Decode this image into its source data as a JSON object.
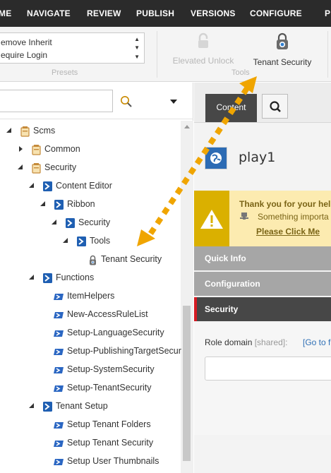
{
  "menu": {
    "items": [
      {
        "key": "home",
        "label": "ME"
      },
      {
        "key": "navigate",
        "label": "NAVIGATE"
      },
      {
        "key": "review",
        "label": "REVIEW"
      },
      {
        "key": "publish",
        "label": "PUBLISH"
      },
      {
        "key": "versions",
        "label": "VERSIONS"
      },
      {
        "key": "configure",
        "label": "CONFIGURE"
      },
      {
        "key": "more",
        "label": "P"
      }
    ]
  },
  "ribbon": {
    "presets_list": [
      "emove Inherit",
      "equire Login"
    ],
    "presets_group_label": "Presets",
    "tools_group_label": "Tools",
    "elevated_unlock_label": "Elevated Unlock",
    "tenant_security_label": "Tenant Security"
  },
  "tree": {
    "search_placeholder": "",
    "nodes": [
      {
        "label": "Scms"
      },
      {
        "label": "Common"
      },
      {
        "label": "Security"
      },
      {
        "label": "Content Editor"
      },
      {
        "label": "Ribbon"
      },
      {
        "label": "Security"
      },
      {
        "label": "Tools"
      },
      {
        "label": "Tenant Security"
      },
      {
        "label": "Functions"
      },
      {
        "label": "ItemHelpers"
      },
      {
        "label": "New-AccessRuleList"
      },
      {
        "label": "Setup-LanguageSecurity"
      },
      {
        "label": "Setup-PublishingTargetSecur"
      },
      {
        "label": "Setup-SystemSecurity"
      },
      {
        "label": "Setup-TenantSecurity"
      },
      {
        "label": "Tenant Setup"
      },
      {
        "label": "Setup Tenant Folders"
      },
      {
        "label": "Setup Tenant Security"
      },
      {
        "label": "Setup User Thumbnails"
      }
    ]
  },
  "editor": {
    "content_tab_label": "Content",
    "item_title": "play1",
    "notice_line1": "Thank you for your hel",
    "notice_line2": "Something importa",
    "notice_link": "Please Click Me",
    "sections": [
      "Quick Info",
      "Configuration",
      "Security"
    ],
    "role_domain_label": "Role domain",
    "role_domain_shared": "[shared]:",
    "go_link": "[Go to f"
  },
  "colors": {
    "menubar_bg": "#2b2b2b",
    "annotation_arrow": "#f0a500",
    "section_active_accent": "#d51b23",
    "powershell_blue": "#1f5fb2",
    "warning_yellow": "#dab000"
  }
}
